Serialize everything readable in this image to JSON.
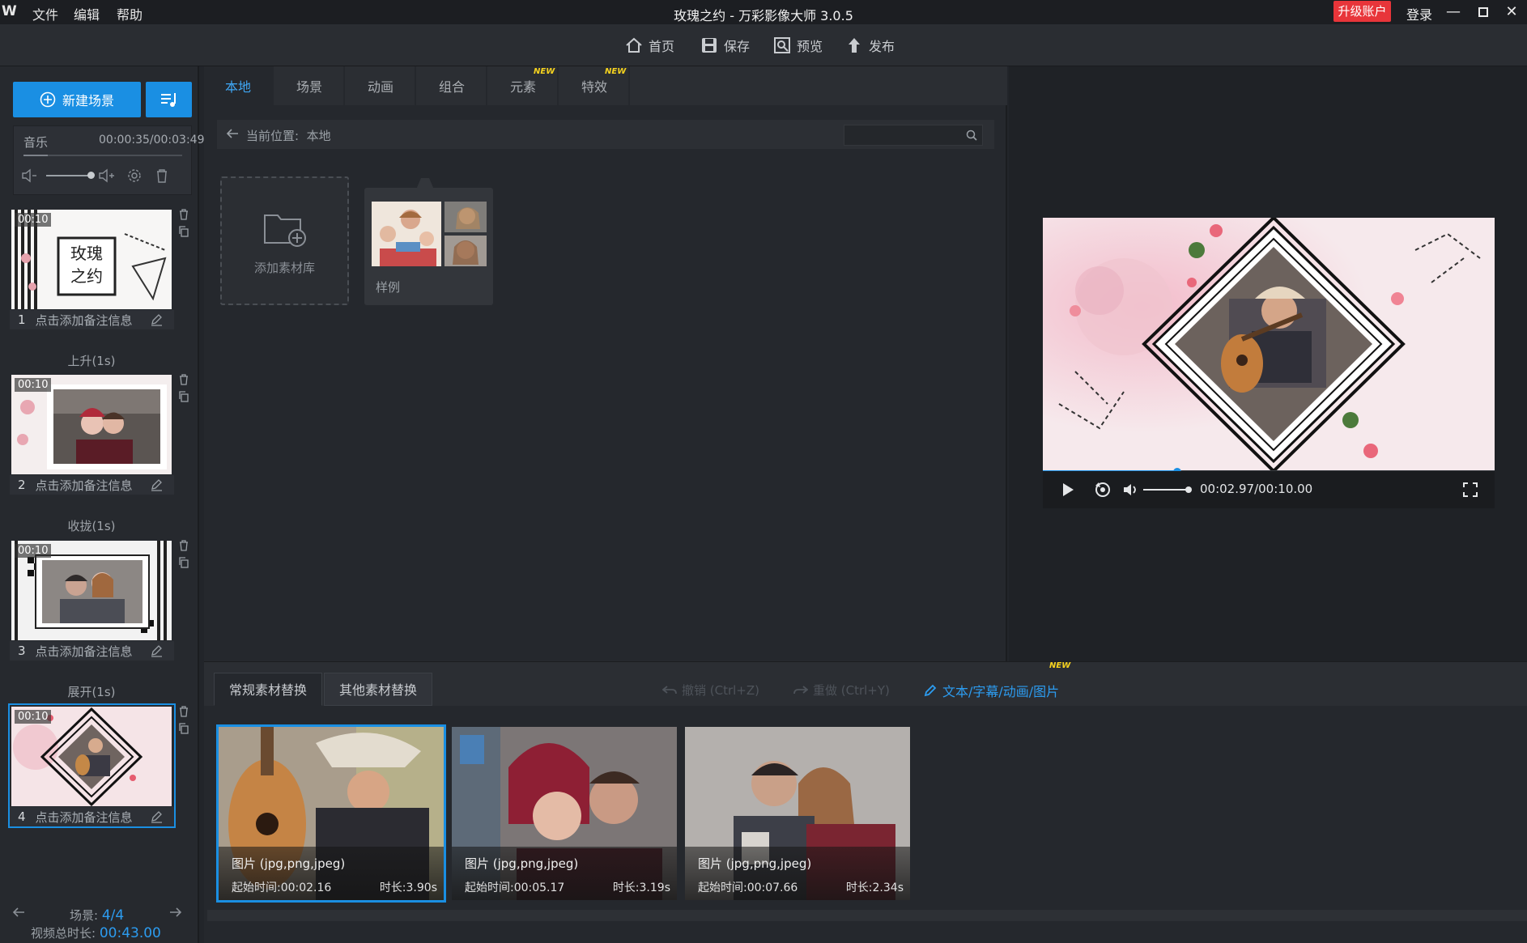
{
  "app": {
    "logo": "W",
    "title": "玫瑰之约 - 万彩影像大师 3.0.5",
    "upgrade": "升级账户",
    "login": "登录"
  },
  "menu": [
    "文件",
    "编辑",
    "帮助"
  ],
  "toolbar": {
    "home": "首页",
    "save": "保存",
    "preview": "预览",
    "publish": "发布"
  },
  "left": {
    "new_scene": "新建场景",
    "music": {
      "label": "音乐",
      "time": "00:00:35/00:03:49"
    },
    "scenes": [
      {
        "num": "1",
        "time": "00:10",
        "note": "点击添加备注信息",
        "title_line1": "玫瑰",
        "title_line2": "之约"
      },
      {
        "num": "2",
        "time": "00:10",
        "note": "点击添加备注信息"
      },
      {
        "num": "3",
        "time": "00:10",
        "note": "点击添加备注信息"
      },
      {
        "num": "4",
        "time": "00:10",
        "note": "点击添加备注信息"
      }
    ],
    "transitions": [
      "上升(1s)",
      "收拢(1s)",
      "展开(1s)"
    ],
    "footer": {
      "scene_label": "场景:",
      "scene_value": "4/4",
      "total_label": "视频总时长:",
      "total_value": "00:43.00"
    }
  },
  "center": {
    "tabs": [
      "本地",
      "场景",
      "动画",
      "组合",
      "元素",
      "特效"
    ],
    "new_badge": "NEW",
    "path_label": "当前位置:",
    "path_value": "本地",
    "search_placeholder": "",
    "add_library": "添加素材库",
    "sample": "样例"
  },
  "preview": {
    "time": "00:02.97/00:10.00",
    "progress": 0.298,
    "volume": 1.0
  },
  "bottom": {
    "tabs": [
      "常规素材替换",
      "其他素材替换"
    ],
    "undo": "撤销 (Ctrl+Z)",
    "redo": "重做 (Ctrl+Y)",
    "edit_link": "文本/字幕/动画/图片",
    "new_badge": "NEW",
    "cards": [
      {
        "type": "图片 (jpg,png,jpeg)",
        "start": "起始时间:00:02.16",
        "duration": "时长:3.90s"
      },
      {
        "type": "图片 (jpg,png,jpeg)",
        "start": "起始时间:00:05.17",
        "duration": "时长:3.19s"
      },
      {
        "type": "图片 (jpg,png,jpeg)",
        "start": "起始时间:00:07.66",
        "duration": "时长:2.34s"
      }
    ]
  },
  "colors": {
    "accent": "#1a8fe3",
    "upgrade": "#e8353a",
    "badge": "#f6d31f",
    "link": "#2c9cf0"
  }
}
